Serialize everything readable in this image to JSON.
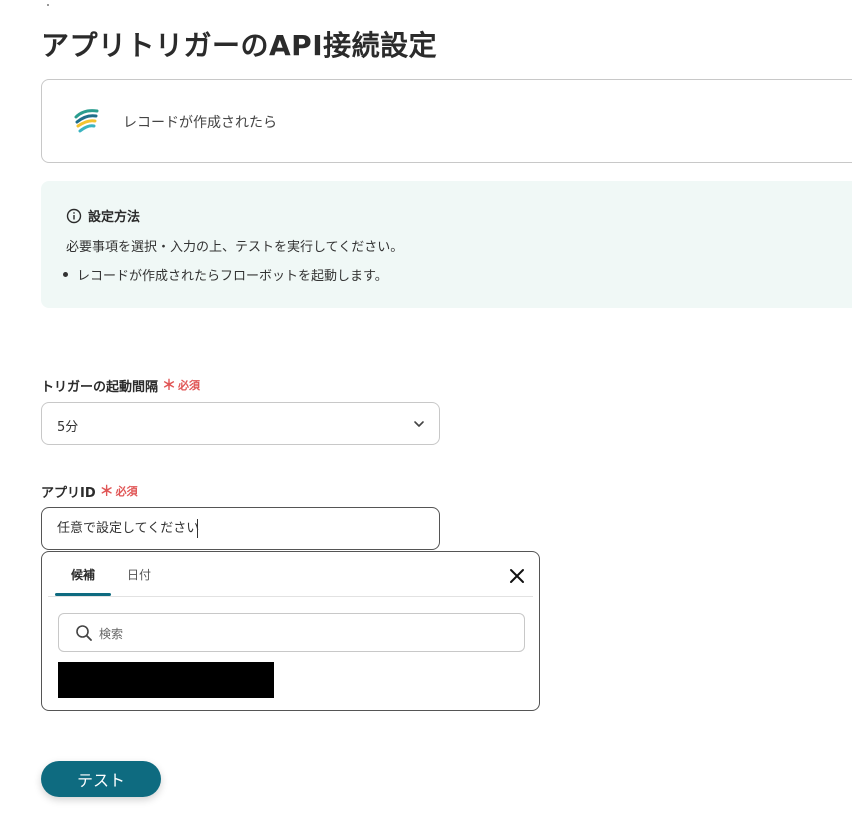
{
  "page": {
    "title": "アプリトリガーのAPI接続設定"
  },
  "trigger": {
    "label": "レコードが作成されたら",
    "logo_icon": "kintone-style-app-logo"
  },
  "info": {
    "icon": "info-circle-icon",
    "heading": "設定方法",
    "text": "必要事項を選択・入力の上、テストを実行してください。",
    "bullets": [
      "レコードが作成されたらフローボットを起動します。"
    ]
  },
  "fields": {
    "interval": {
      "label": "トリガーの起動間隔",
      "required_mark": "＊",
      "required_text": "必須",
      "selected": "5分"
    },
    "app_id": {
      "label": "アプリID",
      "required_mark": "＊",
      "required_text": "必須",
      "placeholder": "任意で設定してください"
    }
  },
  "suggest": {
    "tabs": [
      {
        "label": "候補",
        "active": true
      },
      {
        "label": "日付",
        "active": false
      }
    ],
    "search_placeholder": "検索"
  },
  "actions": {
    "test_label": "テスト"
  },
  "colors": {
    "accent": "#0e6b80",
    "required": "#e05555",
    "info_bg": "#f0f8f6"
  }
}
